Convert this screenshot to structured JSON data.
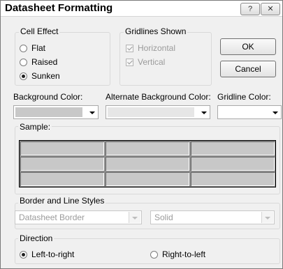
{
  "window": {
    "title": "Datasheet Formatting",
    "help_label": "?",
    "close_label": "✕"
  },
  "cell_effect": {
    "label": "Cell Effect",
    "options": [
      {
        "label": "Flat",
        "selected": false
      },
      {
        "label": "Raised",
        "selected": false
      },
      {
        "label": "Sunken",
        "selected": true
      }
    ]
  },
  "gridlines": {
    "label": "Gridlines Shown",
    "options": [
      {
        "label": "Horizontal",
        "checked": true,
        "enabled": false
      },
      {
        "label": "Vertical",
        "checked": true,
        "enabled": false
      }
    ]
  },
  "buttons": {
    "ok": "OK",
    "cancel": "Cancel"
  },
  "colors": {
    "background_label": "Background Color:",
    "background_value": "#c8c8c8",
    "alternate_label": "Alternate Background Color:",
    "alternate_value": "#e6e6e6",
    "gridline_label": "Gridline Color:",
    "gridline_value": "#ffffff"
  },
  "sample": {
    "label": "Sample:"
  },
  "border_styles": {
    "label": "Border and Line Styles",
    "border_value": "Datasheet Border",
    "line_value": "Solid"
  },
  "direction": {
    "label": "Direction",
    "options": [
      {
        "label": "Left-to-right",
        "selected": true
      },
      {
        "label": "Right-to-left",
        "selected": false
      }
    ]
  }
}
